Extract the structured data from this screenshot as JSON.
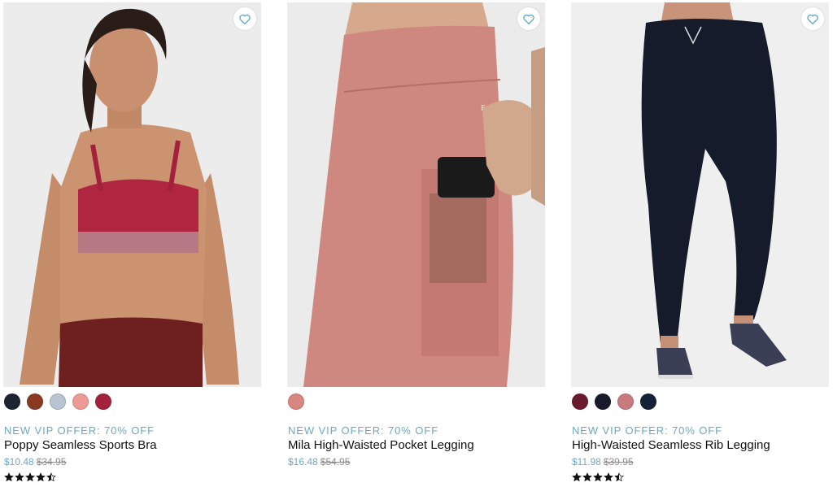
{
  "products": [
    {
      "offer": "NEW VIP OFFER: 70% OFF",
      "name": "Poppy Seamless Sports Bra",
      "sale_price": "$10.48",
      "original_price": "$34.95",
      "rating": 4.5,
      "swatches": [
        "#1c2333",
        "#8a3a22",
        "#b8c4d1",
        "#ee9a94",
        "#a3213a"
      ]
    },
    {
      "offer": "NEW VIP OFFER: 70% OFF",
      "name": "Mila High-Waisted Pocket Legging",
      "sale_price": "$16.48",
      "original_price": "$54.95",
      "rating": null,
      "swatches": [
        "#d88780"
      ]
    },
    {
      "offer": "NEW VIP OFFER: 70% OFF",
      "name": "High-Waisted Seamless Rib Legging",
      "sale_price": "$11.98",
      "original_price": "$39.95",
      "rating": 4.5,
      "swatches": [
        "#6a1a2c",
        "#161a2b",
        "#c97a7e",
        "#152236"
      ]
    }
  ],
  "colors": {
    "offer_accent": "#6fa7bd",
    "wishlist_icon": "#5aa5bf"
  },
  "icons": {
    "wishlist": "heart-outline-icon",
    "rating": "star-icon"
  }
}
